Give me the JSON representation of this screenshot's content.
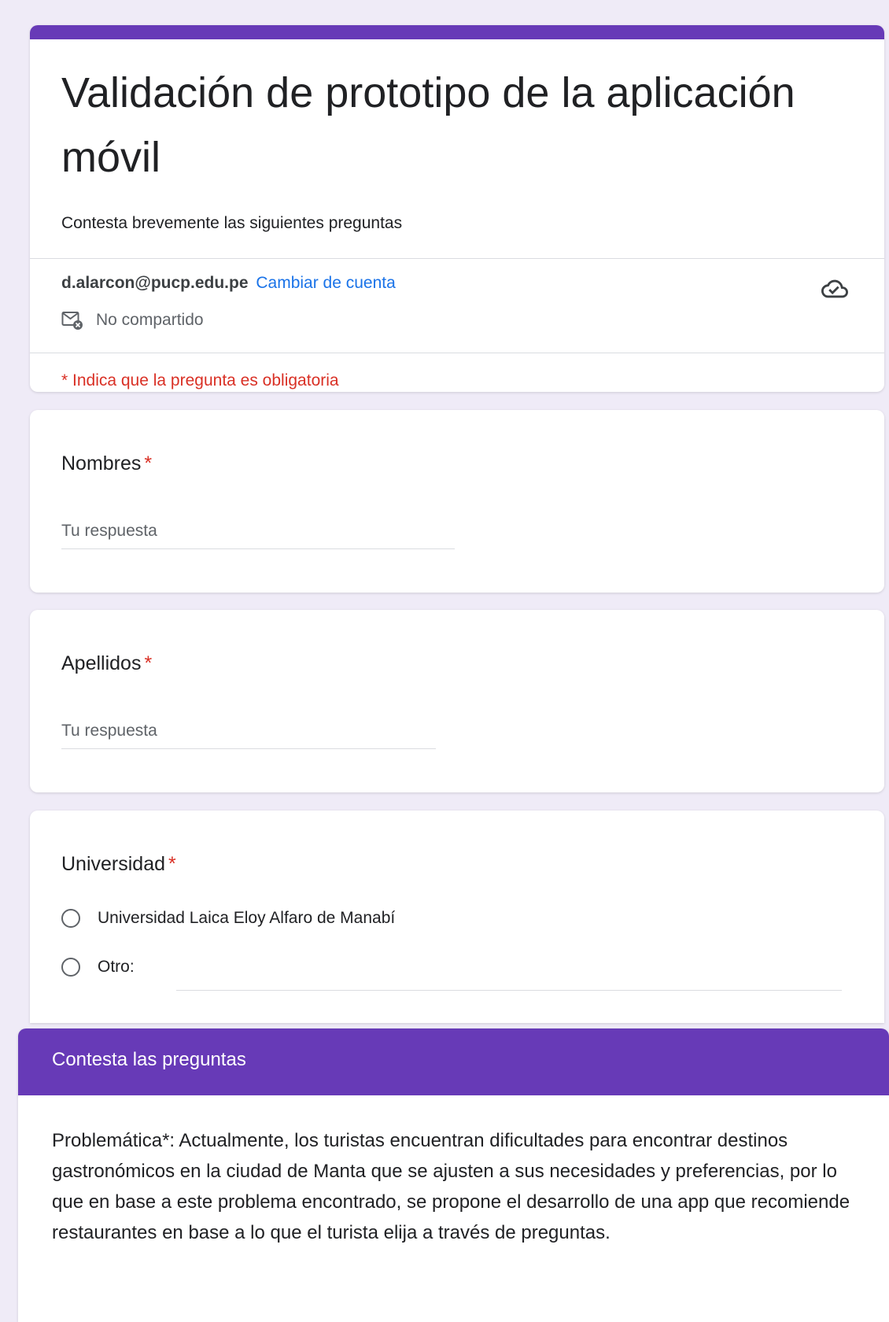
{
  "form": {
    "title": "Validación de prototipo de la aplicación móvil",
    "description": "Contesta brevemente las siguientes preguntas",
    "account_email": "d.alarcon@pucp.edu.pe",
    "switch_account_label": "Cambiar de cuenta",
    "not_shared_label": "No compartido",
    "required_note": "* Indica que la pregunta es obligatoria",
    "accent_color": "#673ab7",
    "required_color": "#d93025",
    "link_color": "#1a73e8"
  },
  "questions": [
    {
      "title": "Nombres",
      "required_mark": "*",
      "placeholder": "Tu respuesta"
    },
    {
      "title": "Apellidos",
      "required_mark": "*",
      "placeholder": "Tu respuesta"
    },
    {
      "title": "Universidad",
      "required_mark": "*",
      "options": [
        "Universidad Laica Eloy Alfaro de Manabí",
        "Otro:"
      ]
    }
  ],
  "section": {
    "title": "Contesta las preguntas",
    "body": "Problemática*:  Actualmente, los turistas encuentran dificultades para encontrar destinos gastronómicos en la ciudad de Manta que se ajusten a sus necesidades y preferencias, por lo que en base a este problema encontrado, se propone el desarrollo de una app que recomiende restaurantes en base a lo que el turista elija a través de preguntas."
  }
}
